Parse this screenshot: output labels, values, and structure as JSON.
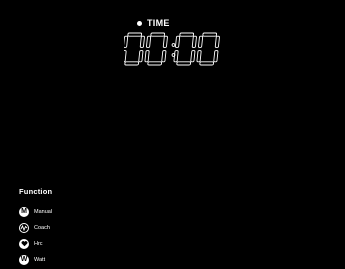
{
  "time": {
    "label": "TIME",
    "value": "00:00"
  },
  "function": {
    "title": "Function",
    "items": [
      {
        "icon": "manual-m-icon",
        "glyph": "M",
        "label": "Manual"
      },
      {
        "icon": "coach-wave-icon",
        "glyph": "",
        "label": "Coach"
      },
      {
        "icon": "heart-icon",
        "glyph": "",
        "label": "Hrc"
      },
      {
        "icon": "watt-w-icon",
        "glyph": "W",
        "label": "Watt"
      }
    ]
  },
  "colors": {
    "background": "#000000",
    "foreground": "#ffffff"
  }
}
